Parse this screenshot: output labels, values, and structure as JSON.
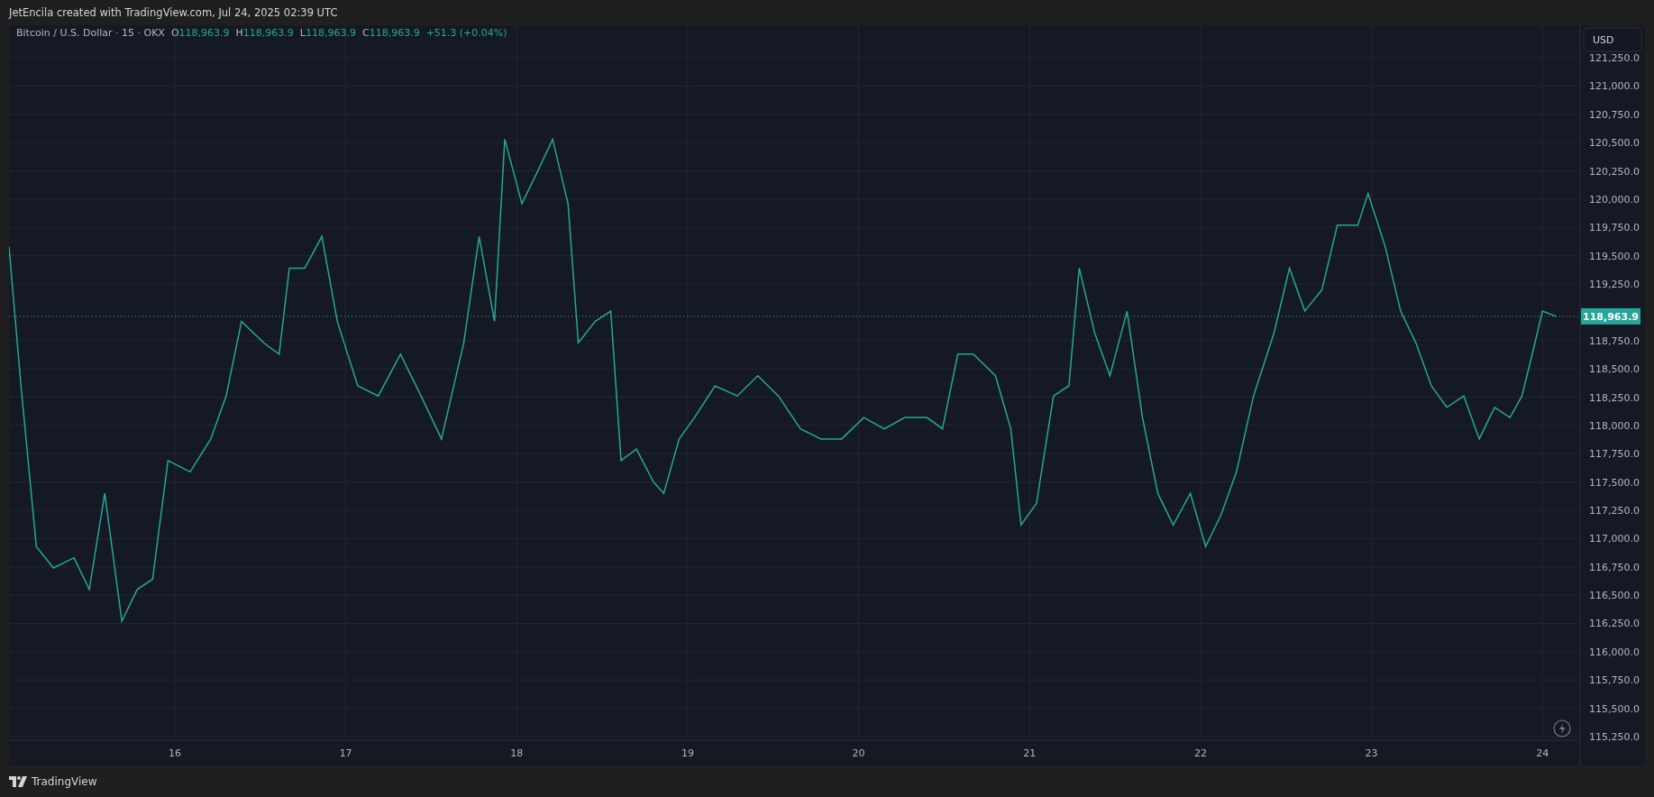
{
  "header": {
    "caption": "JetEncila created with TradingView.com, Jul 24, 2025 02:39 UTC"
  },
  "legend": {
    "symbol": "Bitcoin / U.S. Dollar · 15 · OKX",
    "ohlc": [
      {
        "label": "O",
        "value": "118,963.9"
      },
      {
        "label": "H",
        "value": "118,963.9"
      },
      {
        "label": "L",
        "value": "118,963.9"
      },
      {
        "label": "C",
        "value": "118,963.9"
      }
    ],
    "change": "+51.3 (+0.04%)"
  },
  "currency": "USD",
  "last_price": {
    "label": "118,963.9"
  },
  "chart_data": {
    "type": "line",
    "grid": true,
    "xlim": [
      15.03,
      24.22
    ],
    "ylim": [
      115218,
      121537
    ],
    "xticks": [
      {
        "value": 16,
        "label": "16"
      },
      {
        "value": 17,
        "label": "17"
      },
      {
        "value": 18,
        "label": "18"
      },
      {
        "value": 19,
        "label": "19"
      },
      {
        "value": 20,
        "label": "20"
      },
      {
        "value": 21,
        "label": "21"
      },
      {
        "value": 22,
        "label": "22"
      },
      {
        "value": 23,
        "label": "23"
      },
      {
        "value": 24,
        "label": "24"
      }
    ],
    "yticks": [
      {
        "value": 115250,
        "label": "115,250.0"
      },
      {
        "value": 115500,
        "label": "115,500.0"
      },
      {
        "value": 115750,
        "label": "115,750.0"
      },
      {
        "value": 116000,
        "label": "116,000.0"
      },
      {
        "value": 116250,
        "label": "116,250.0"
      },
      {
        "value": 116500,
        "label": "116,500.0"
      },
      {
        "value": 116750,
        "label": "116,750.0"
      },
      {
        "value": 117000,
        "label": "117,000.0"
      },
      {
        "value": 117250,
        "label": "117,250.0"
      },
      {
        "value": 117500,
        "label": "117,500.0"
      },
      {
        "value": 117750,
        "label": "117,750.0"
      },
      {
        "value": 118000,
        "label": "118,000.0"
      },
      {
        "value": 118250,
        "label": "118,250.0"
      },
      {
        "value": 118500,
        "label": "118,500.0"
      },
      {
        "value": 118750,
        "label": "118,750.0"
      },
      {
        "value": 119250,
        "label": "119,250.0"
      },
      {
        "value": 119500,
        "label": "119,500.0"
      },
      {
        "value": 119750,
        "label": "119,750.0"
      },
      {
        "value": 120000,
        "label": "120,000.0"
      },
      {
        "value": 120250,
        "label": "120,250.0"
      },
      {
        "value": 120500,
        "label": "120,500.0"
      },
      {
        "value": 120750,
        "label": "120,750.0"
      },
      {
        "value": 121000,
        "label": "121,000.0"
      },
      {
        "value": 121250,
        "label": "121,250.0"
      }
    ],
    "x": [
      15.03,
      15.1,
      15.19,
      15.29,
      15.41,
      15.5,
      15.59,
      15.69,
      15.78,
      15.87,
      15.96,
      16.09,
      16.21,
      16.3,
      16.39,
      16.52,
      16.61,
      16.67,
      16.76,
      16.86,
      16.95,
      17.07,
      17.19,
      17.32,
      17.44,
      17.56,
      17.69,
      17.78,
      17.87,
      17.93,
      18.03,
      18.12,
      18.21,
      18.3,
      18.36,
      18.46,
      18.55,
      18.61,
      18.7,
      18.8,
      18.86,
      18.95,
      19.04,
      19.16,
      19.29,
      19.41,
      19.53,
      19.66,
      19.78,
      19.9,
      20.03,
      20.15,
      20.27,
      20.4,
      20.49,
      20.58,
      20.67,
      20.8,
      20.89,
      20.95,
      21.04,
      21.14,
      21.23,
      21.29,
      21.38,
      21.47,
      21.57,
      21.66,
      21.75,
      21.84,
      21.94,
      22.03,
      22.12,
      22.21,
      22.31,
      22.43,
      22.52,
      22.61,
      22.71,
      22.8,
      22.92,
      22.98,
      23.08,
      23.17,
      23.26,
      23.35,
      23.44,
      23.54,
      23.63,
      23.72,
      23.81,
      23.88,
      23.94,
      24.0,
      24.08
    ],
    "series": [
      {
        "color": "#26a69a",
        "values": [
          119580,
          118350,
          116930,
          116740,
          116830,
          116550,
          117400,
          116270,
          116550,
          116640,
          117690,
          117590,
          117880,
          118260,
          118920,
          118730,
          118630,
          119390,
          119390,
          119670,
          118920,
          118350,
          118260,
          118630,
          118260,
          117880,
          118730,
          119670,
          118920,
          120530,
          119960,
          120240,
          120530,
          119960,
          118730,
          118920,
          119010,
          117690,
          117790,
          117500,
          117400,
          117880,
          118070,
          118350,
          118260,
          118440,
          118260,
          117970,
          117880,
          117880,
          118070,
          117970,
          118070,
          118070,
          117970,
          118630,
          118630,
          118440,
          117970,
          117120,
          117310,
          118260,
          118350,
          119390,
          118820,
          118440,
          119010,
          118070,
          117400,
          117120,
          117400,
          116930,
          117210,
          117590,
          118260,
          118820,
          119390,
          119010,
          119200,
          119770,
          119770,
          120050,
          119580,
          119010,
          118730,
          118350,
          118160,
          118260,
          117880,
          118160,
          118070,
          118260,
          118630,
          119010,
          118964
        ]
      }
    ]
  },
  "footer": {
    "brand": "TradingView"
  }
}
